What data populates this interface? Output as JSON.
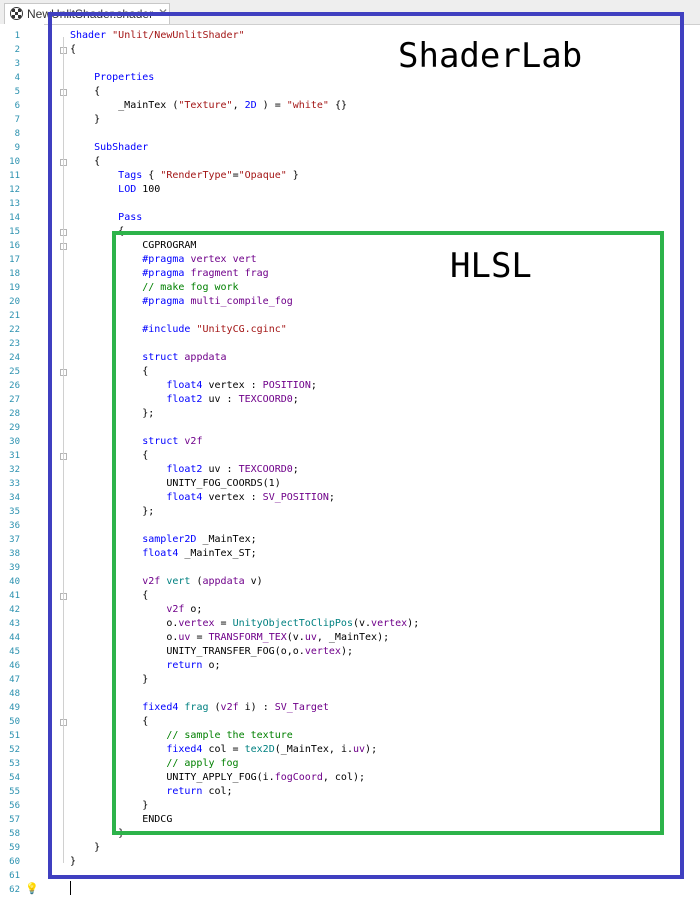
{
  "tab": {
    "label": "NewUnlitShader.shader",
    "icon": "shader-icon"
  },
  "labels": {
    "shaderlab": "ShaderLab",
    "hlsl": "HLSL"
  },
  "lines": [
    [
      [
        "kw",
        "Shader "
      ],
      [
        "str",
        "\"Unlit/NewUnlitShader\""
      ]
    ],
    [
      [
        "",
        "{"
      ]
    ],
    [],
    [
      [
        "",
        "    "
      ],
      [
        "kw",
        "Properties"
      ]
    ],
    [
      [
        "",
        "    {"
      ]
    ],
    [
      [
        "",
        "        _MainTex ("
      ],
      [
        "str",
        "\"Texture\""
      ],
      [
        "",
        ", "
      ],
      [
        "kw",
        "2D"
      ],
      [
        "",
        " ) = "
      ],
      [
        "str",
        "\"white\""
      ],
      [
        "",
        " {}"
      ]
    ],
    [
      [
        "",
        "    }"
      ]
    ],
    [],
    [
      [
        "",
        "    "
      ],
      [
        "kw",
        "SubShader"
      ]
    ],
    [
      [
        "",
        "    {"
      ]
    ],
    [
      [
        "",
        "        "
      ],
      [
        "kw",
        "Tags"
      ],
      [
        "",
        " { "
      ],
      [
        "str",
        "\"RenderType\""
      ],
      [
        "",
        "="
      ],
      [
        "str",
        "\"Opaque\""
      ],
      [
        "",
        " }"
      ]
    ],
    [
      [
        "",
        "        "
      ],
      [
        "kw",
        "LOD"
      ],
      [
        "",
        " 100"
      ]
    ],
    [],
    [
      [
        "",
        "        "
      ],
      [
        "kw",
        "Pass"
      ]
    ],
    [
      [
        "",
        "        {"
      ]
    ],
    [
      [
        "",
        "            CGPROGRAM"
      ]
    ],
    [
      [
        "",
        "            "
      ],
      [
        "pp",
        "#pragma"
      ],
      [
        "",
        " "
      ],
      [
        "mac",
        "vertex vert"
      ]
    ],
    [
      [
        "",
        "            "
      ],
      [
        "pp",
        "#pragma"
      ],
      [
        "",
        " "
      ],
      [
        "mac",
        "fragment frag"
      ]
    ],
    [
      [
        "",
        "            "
      ],
      [
        "cmt",
        "// make fog work"
      ]
    ],
    [
      [
        "",
        "            "
      ],
      [
        "pp",
        "#pragma"
      ],
      [
        "",
        " "
      ],
      [
        "mac",
        "multi_compile_fog"
      ]
    ],
    [],
    [
      [
        "",
        "            "
      ],
      [
        "pp",
        "#include"
      ],
      [
        "",
        " "
      ],
      [
        "str",
        "\"UnityCG.cginc\""
      ]
    ],
    [],
    [
      [
        "",
        "            "
      ],
      [
        "kw",
        "struct"
      ],
      [
        "",
        " "
      ],
      [
        "mac",
        "appdata"
      ]
    ],
    [
      [
        "",
        "            {"
      ]
    ],
    [
      [
        "",
        "                "
      ],
      [
        "ty",
        "float4"
      ],
      [
        "",
        " vertex : "
      ],
      [
        "mac",
        "POSITION"
      ],
      [
        "",
        ";"
      ]
    ],
    [
      [
        "",
        "                "
      ],
      [
        "ty",
        "float2"
      ],
      [
        "",
        " uv : "
      ],
      [
        "mac",
        "TEXCOORD0"
      ],
      [
        "",
        ";"
      ]
    ],
    [
      [
        "",
        "            };"
      ]
    ],
    [],
    [
      [
        "",
        "            "
      ],
      [
        "kw",
        "struct"
      ],
      [
        "",
        " "
      ],
      [
        "mac",
        "v2f"
      ]
    ],
    [
      [
        "",
        "            {"
      ]
    ],
    [
      [
        "",
        "                "
      ],
      [
        "ty",
        "float2"
      ],
      [
        "",
        " uv : "
      ],
      [
        "mac",
        "TEXCOORD0"
      ],
      [
        "",
        ";"
      ]
    ],
    [
      [
        "",
        "                UNITY_FOG_COORDS(1)"
      ]
    ],
    [
      [
        "",
        "                "
      ],
      [
        "ty",
        "float4"
      ],
      [
        "",
        " vertex : "
      ],
      [
        "mac",
        "SV_POSITION"
      ],
      [
        "",
        ";"
      ]
    ],
    [
      [
        "",
        "            };"
      ]
    ],
    [],
    [
      [
        "",
        "            "
      ],
      [
        "ty",
        "sampler2D"
      ],
      [
        "",
        " _MainTex;"
      ]
    ],
    [
      [
        "",
        "            "
      ],
      [
        "ty",
        "float4"
      ],
      [
        "",
        " _MainTex_ST;"
      ]
    ],
    [],
    [
      [
        "",
        "            "
      ],
      [
        "mac",
        "v2f"
      ],
      [
        "",
        " "
      ],
      [
        "fn",
        "vert"
      ],
      [
        "",
        " ("
      ],
      [
        "mac",
        "appdata"
      ],
      [
        "",
        " v)"
      ]
    ],
    [
      [
        "",
        "            {"
      ]
    ],
    [
      [
        "",
        "                "
      ],
      [
        "mac",
        "v2f"
      ],
      [
        "",
        " o;"
      ]
    ],
    [
      [
        "",
        "                o."
      ],
      [
        "mac",
        "vertex"
      ],
      [
        "",
        " = "
      ],
      [
        "fn",
        "UnityObjectToClipPos"
      ],
      [
        "",
        "(v."
      ],
      [
        "mac",
        "vertex"
      ],
      [
        "",
        ");"
      ]
    ],
    [
      [
        "",
        "                o."
      ],
      [
        "mac",
        "uv"
      ],
      [
        "",
        " = "
      ],
      [
        "mac",
        "TRANSFORM_TEX"
      ],
      [
        "",
        "(v."
      ],
      [
        "mac",
        "uv"
      ],
      [
        "",
        ", _MainTex);"
      ]
    ],
    [
      [
        "",
        "                UNITY_TRANSFER_FOG(o,o."
      ],
      [
        "mac",
        "vertex"
      ],
      [
        "",
        ");"
      ]
    ],
    [
      [
        "",
        "                "
      ],
      [
        "kw",
        "return"
      ],
      [
        "",
        " o;"
      ]
    ],
    [
      [
        "",
        "            }"
      ]
    ],
    [],
    [
      [
        "",
        "            "
      ],
      [
        "ty",
        "fixed4"
      ],
      [
        "",
        " "
      ],
      [
        "fn",
        "frag"
      ],
      [
        "",
        " ("
      ],
      [
        "mac",
        "v2f"
      ],
      [
        "",
        " i) : "
      ],
      [
        "mac",
        "SV_Target"
      ]
    ],
    [
      [
        "",
        "            {"
      ]
    ],
    [
      [
        "",
        "                "
      ],
      [
        "cmt",
        "// sample the texture"
      ]
    ],
    [
      [
        "",
        "                "
      ],
      [
        "ty",
        "fixed4"
      ],
      [
        "",
        " col = "
      ],
      [
        "fn",
        "tex2D"
      ],
      [
        "",
        "(_MainTex, i."
      ],
      [
        "mac",
        "uv"
      ],
      [
        "",
        ");"
      ]
    ],
    [
      [
        "",
        "                "
      ],
      [
        "cmt",
        "// apply fog"
      ]
    ],
    [
      [
        "",
        "                UNITY_APPLY_FOG(i."
      ],
      [
        "mac",
        "fogCoord"
      ],
      [
        "",
        ", col);"
      ]
    ],
    [
      [
        "",
        "                "
      ],
      [
        "kw",
        "return"
      ],
      [
        "",
        " col;"
      ]
    ],
    [
      [
        "",
        "            }"
      ]
    ],
    [
      [
        "",
        "            ENDCG"
      ]
    ],
    [
      [
        "",
        "        }"
      ]
    ],
    [
      [
        "",
        "    }"
      ]
    ],
    [
      [
        "",
        "}"
      ]
    ],
    [],
    []
  ],
  "fold_lines": [
    2,
    5,
    10,
    15,
    16,
    25,
    31,
    41,
    50
  ]
}
